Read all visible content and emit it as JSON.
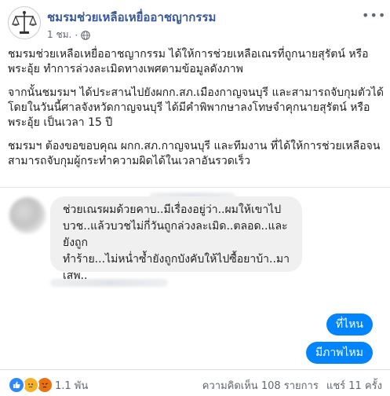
{
  "header": {
    "page_name": "ชมรมช่วยเหลือเหยื่ออาชญากรรม",
    "time": "1 ชม.",
    "more_icon": "ellipsis-icon"
  },
  "post": {
    "paragraphs": [
      "ชมรมช่วยเหลือเหยื่ออาชญากรรม ได้ให้การช่วยเหลือเณรที่ถูกนายสุรัตน์ หรือ พระอุ้ย ทำการล่วงละเมิดทางเพศตามข้อมูลดังภาพ",
      "จากนั้นชมรมฯ ได้ประสานไปยังผกก.สภ.เมืองกาญจนบุรี และสามารถจับกุมตัวได้ โดยในวันนี้ศาลจังหวัดกาญจนบุรี ได้มีคำพิพากษาลงโทษจำคุกนายสุรัตน์ หรือ พระอุ้ย เป็นเวลา 15 ปี",
      "ชมรมฯ ต้องขอขอบคุณ ผกก.สภ.กาญจนบุรี และทีมงาน ที่ได้ให้การช่วยเหลือจนสามารถจับกุมผู้กระทำความผิดได้ในเวลาอันรวดเร็ว"
    ]
  },
  "chat": {
    "incoming_message": "ช่วยเณรผมด้วยคาบ..มีเรื่องอยู่ว่า..ผมให้เขาไป\nบวช..แล้วบวชไม่กี่วันถูกล่วงละเมิด..ตลอด..และยังถูก\nทำร้าย...ไม่หน่ำซ้ำยังถูกบังคับให้ไปซื้อยาบ้า..มา\nเสพ..",
    "outgoing_messages": [
      "ที่ไหน",
      "มีภาพไหม"
    ],
    "outgoing_color": "#0084ff"
  },
  "footer": {
    "reaction_icons": [
      "like-icon",
      "sad-icon",
      "angry-icon"
    ],
    "reaction_count": "1.1 พัน",
    "comments": "ความคิดเห็น 108 รายการ",
    "shares": "แชร์ 11 ครั้ง"
  },
  "colors": {
    "link": "#385898",
    "meta": "#606770",
    "bubble_gray": "#f1f0f0"
  }
}
